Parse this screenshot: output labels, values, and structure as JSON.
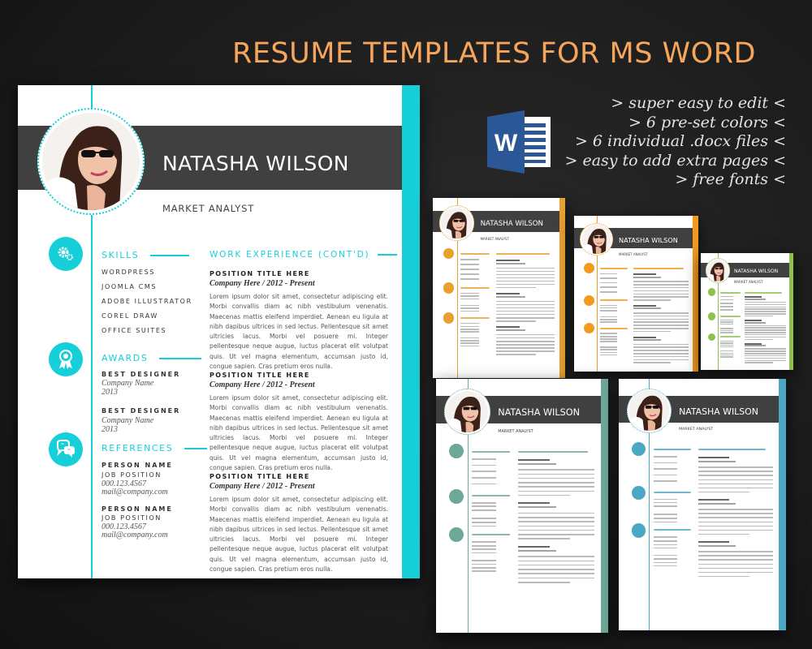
{
  "headline": "RESUME TEMPLATES FOR MS WORD",
  "features": [
    "> super easy to edit <",
    "> 6 pre-set colors  <",
    "> 6 individual .docx files <",
    "> easy to add extra pages <",
    "> free fonts <"
  ],
  "word_icon": {
    "letter": "W",
    "color": "#2b5797"
  },
  "resume": {
    "name": "NATASHA WILSON",
    "role": "MARKET ANALYST",
    "accent_color": "#17cfd8",
    "sections": {
      "skills": {
        "title": "SKILLS",
        "icon": "gears-icon",
        "items": [
          "WORDPRESS",
          "JOOMLA CMS",
          "ADOBE ILLUSTRATOR",
          "COREL DRAW",
          "OFFICE SUITES"
        ]
      },
      "awards": {
        "title": "AWARDS",
        "icon": "award-ribbon-icon",
        "items": [
          {
            "title": "BEST DESIGNER",
            "company": "Company Name",
            "year": "2013"
          },
          {
            "title": "BEST DESIGNER",
            "company": "Company Name",
            "year": "2013"
          }
        ]
      },
      "references": {
        "title": "REFERENCES",
        "icon": "speech-bubbles-icon",
        "items": [
          {
            "name": "PERSON NAME",
            "position": "JOB POSITION",
            "phone": "000.123.4567",
            "email": "mail@company.com"
          },
          {
            "name": "PERSON NAME",
            "position": "JOB POSITION",
            "phone": "000.123.4567",
            "email": "mail@company.com"
          }
        ]
      },
      "work": {
        "title": "WORK EXPERIENCE (CONT'D)",
        "jobs": [
          {
            "position": "POSITION TITLE HERE",
            "company": "Company Here / 2012 - Present",
            "description": "Lorem ipsum dolor sit amet, consectetur adipiscing elit. Morbi convallis diam ac nibh vestibulum venenatis. Maecenas mattis eleifend imperdiet. Aenean eu ligula at nibh dapibus ultrices in sed lectus. Pellentesque sit amet ultricies lacus. Morbi vel posuere mi. Integer pellentesque neque augue, luctus placerat elit volutpat quis. Ut vel magna elementum, accumsan justo id, congue sapien. Cras pretium eros nulla."
          },
          {
            "position": "POSITION TITLE HERE",
            "company": "Company Here / 2012 - Present",
            "description": "Lorem ipsum dolor sit amet, consectetur adipiscing elit. Morbi convallis diam ac nibh vestibulum venenatis. Maecenas mattis eleifend imperdiet. Aenean eu ligula at nibh dapibus ultrices in sed lectus. Pellentesque sit amet ultricies lacus. Morbi vel posuere mi. Integer pellentesque neque augue, luctus placerat elit volutpat quis. Ut vel magna elementum, accumsan justo id, congue sapien. Cras pretium eros nulla."
          },
          {
            "position": "POSITION TITLE HERE",
            "company": "Company Here / 2012 - Present",
            "description": "Lorem ipsum dolor sit amet, consectetur adipiscing elit. Morbi convallis diam ac nibh vestibulum venenatis. Maecenas mattis eleifend imperdiet. Aenean eu ligula at nibh dapibus ultrices in sed lectus. Pellentesque sit amet ultricies lacus. Morbi vel posuere mi. Integer pellentesque neque augue, luctus placerat elit volutpat quis. Ut vel magna elementum, accumsan justo id, congue sapien. Cras pretium eros nulla."
          }
        ]
      }
    }
  },
  "variants": [
    {
      "id": "orange-1",
      "color": "#e8a030"
    },
    {
      "id": "orange-2",
      "color": "#f39a1e"
    },
    {
      "id": "green",
      "color": "#8fbf4e"
    },
    {
      "id": "sage",
      "color": "#6fa89a"
    },
    {
      "id": "blue",
      "color": "#4ba8c4"
    }
  ]
}
